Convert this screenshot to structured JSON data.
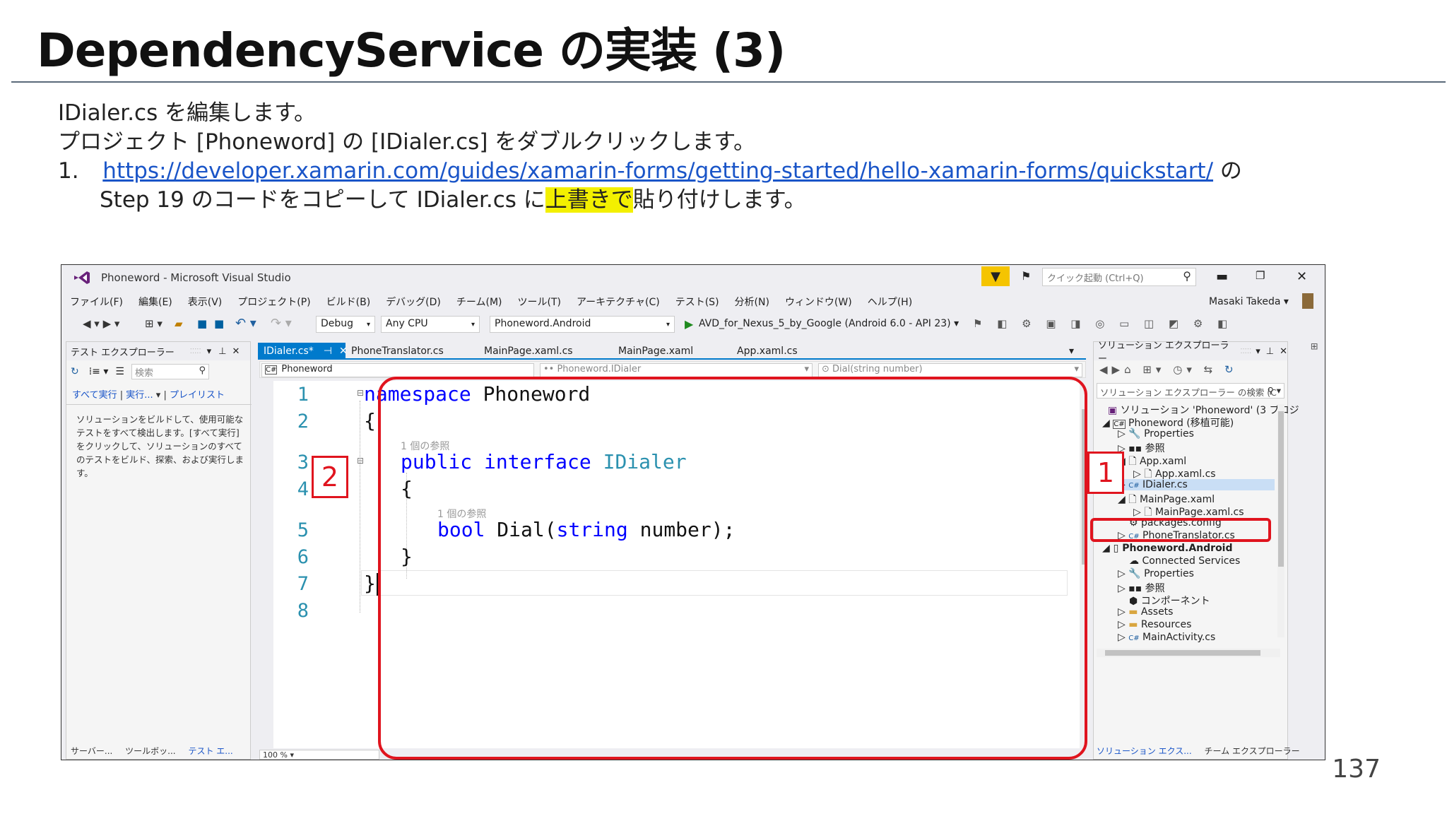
{
  "slide": {
    "title": "DependencyService の実装 (3)",
    "line1": "IDialer.cs を編集します。",
    "line2": "プロジェクト [Phoneword] の [IDialer.cs] をダブルクリックします。",
    "line3_num": "1.",
    "line3_url": "https://developer.xamarin.com/guides/xamarin-forms/getting-started/hello-xamarin-forms/quickstart/",
    "line3_after": " の",
    "line4_pre": "Step 19 のコードをコピーして IDialer.cs に",
    "line4_hl": "上書きで",
    "line4_post": "貼り付けします。",
    "page_number": "137"
  },
  "vs": {
    "window_title": "Phoneword - Microsoft Visual Studio",
    "quick_launch": "クイック起動 (Ctrl+Q)",
    "user": "Masaki Takeda",
    "menu": [
      "ファイル(F)",
      "編集(E)",
      "表示(V)",
      "プロジェクト(P)",
      "ビルド(B)",
      "デバッグ(D)",
      "チーム(M)",
      "ツール(T)",
      "アーキテクチャ(C)",
      "テスト(S)",
      "分析(N)",
      "ウィンドウ(W)",
      "ヘルプ(H)"
    ],
    "toolbar": {
      "config": "Debug",
      "platform": "Any CPU",
      "project": "Phoneword.Android",
      "run_target": "AVD_for_Nexus_5_by_Google (Android 6.0 - API 23)"
    },
    "test_explorer": {
      "title": "テスト エクスプローラー",
      "search_placeholder": "検索",
      "run_all": "すべて実行",
      "run": "実行...",
      "playlist": "プレイリスト",
      "message": "ソリューションをビルドして、使用可能なテストをすべて検出します。[すべて実行] をクリックして、ソリューションのすべてのテストをビルド、探索、および実行します。",
      "bottom_tabs": [
        "サーバー...",
        "ツールボッ...",
        "テスト エ..."
      ]
    },
    "tabs": [
      "IDialer.cs*",
      "PhoneTranslator.cs",
      "MainPage.xaml.cs",
      "MainPage.xaml",
      "App.xaml.cs"
    ],
    "nav": {
      "project": "Phoneword",
      "type": "Phoneword.IDialer",
      "member": "Dial(string number)"
    },
    "zoom": "100 %",
    "code": {
      "line_numbers": [
        "1",
        "2",
        "3",
        "4",
        "5",
        "6",
        "7",
        "8"
      ],
      "ns_kw": "namespace",
      "ns_name": " Phoneword",
      "brace_open": "{",
      "ref1": "1 個の参照",
      "pub_kw": "public",
      "iface_kw": " interface",
      "iface_name": " IDialer",
      "brace_open2": "{",
      "ref2": "1 個の参照",
      "bool_kw": "bool",
      "dial": " Dial(",
      "string_kw": "string",
      "param": " number);",
      "brace_close2": "}",
      "brace_close": "}"
    },
    "solution_explorer": {
      "title": "ソリューション エクスプローラー",
      "search_placeholder": "ソリューション エクスプローラー の検索 (C",
      "items": [
        "ソリューション 'Phoneword' (3 プロジ",
        "Phoneword (移植可能)",
        "Properties",
        "参照",
        "App.xaml",
        "App.xaml.cs",
        "IDialer.cs",
        "MainPage.xaml",
        "MainPage.xaml.cs",
        "packages.config",
        "PhoneTranslator.cs",
        "Phoneword.Android",
        "Connected Services",
        "Properties",
        "参照",
        "コンポーネント",
        "Assets",
        "Resources",
        "MainActivity.cs"
      ],
      "bottom_tabs": [
        "ソリューション エクス...",
        "チーム エクスプローラー"
      ]
    },
    "callouts": [
      "1",
      "2"
    ]
  }
}
